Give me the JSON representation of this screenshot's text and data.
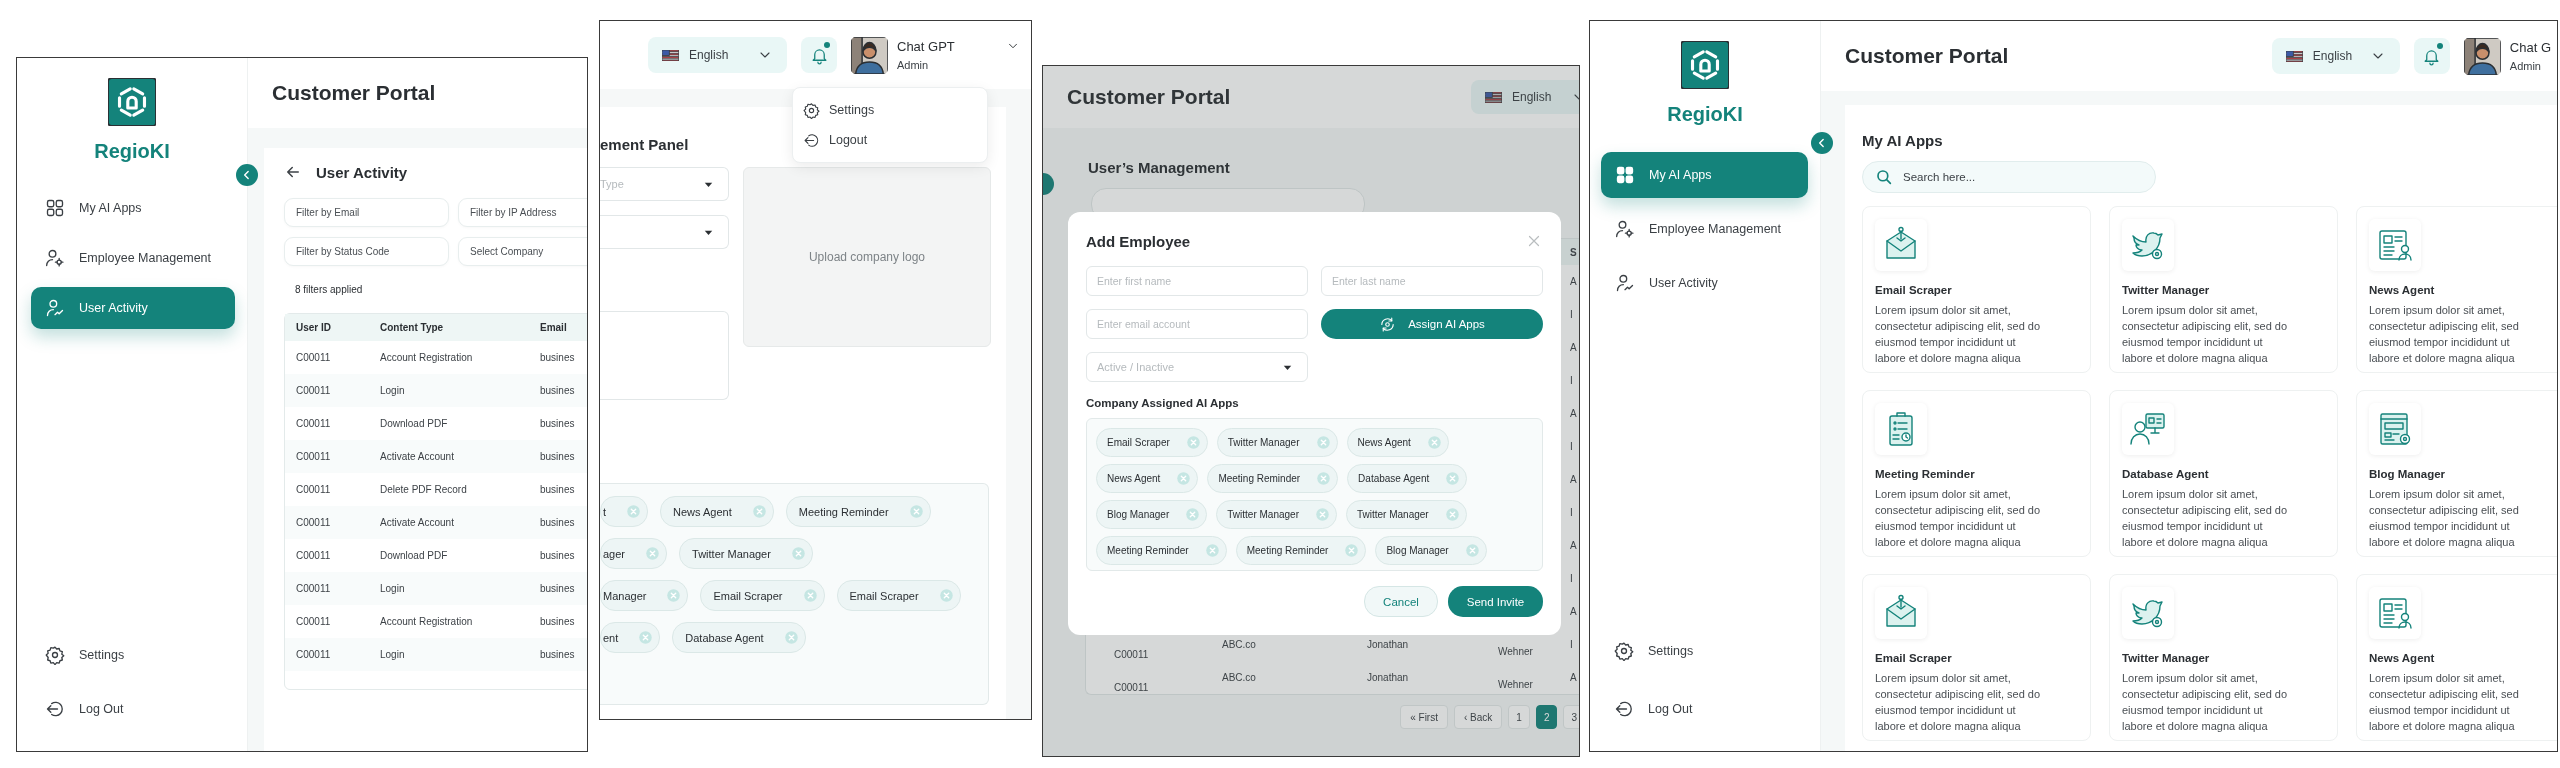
{
  "user_activity_screen": {
    "sidebar": {
      "brand": "RegioKI",
      "items": [
        {
          "label": "My AI Apps",
          "kind": "apps",
          "selected": false
        },
        {
          "label": "Employee Management",
          "kind": "employees",
          "selected": false
        },
        {
          "label": "User Activity",
          "kind": "activity",
          "selected": true
        }
      ],
      "footer_items": [
        {
          "label": "Settings",
          "kind": "settings"
        },
        {
          "label": "Log Out",
          "kind": "logout"
        }
      ]
    },
    "header": {
      "title": "Customer Portal"
    },
    "page": {
      "title": "User Activity",
      "filters": [
        {
          "placeholder": "Filter by Email"
        },
        {
          "placeholder": "Filter by IP Address"
        },
        {
          "placeholder": "Filter by Status Code"
        },
        {
          "placeholder": "Select Company"
        }
      ],
      "filter_count": "8 filters applied",
      "table": {
        "columns": [
          "User ID",
          "Content Type",
          "Email"
        ],
        "rows": [
          [
            "C00011",
            "Account Registration",
            "busines"
          ],
          [
            "C00011",
            "Login",
            "busines"
          ],
          [
            "C00011",
            "Download PDF",
            "busines"
          ],
          [
            "C00011",
            "Activate Account",
            "busines"
          ],
          [
            "C00011",
            "Delete PDF Record",
            "busines"
          ],
          [
            "C00011",
            "Activate Account",
            "busines"
          ],
          [
            "C00011",
            "Download PDF",
            "busines"
          ],
          [
            "C00011",
            "Login",
            "busines"
          ],
          [
            "C00011",
            "Account Registration",
            "busines"
          ],
          [
            "C00011",
            "Login",
            "busines"
          ]
        ]
      }
    }
  },
  "profile_menu_screen": {
    "header": {
      "language": "English",
      "user_name": "Chat GPT",
      "user_role": "Admin"
    },
    "menu": [
      {
        "label": "Settings",
        "kind": "settings"
      },
      {
        "label": "Logout",
        "kind": "logout"
      }
    ],
    "page": {
      "title": "ement Panel",
      "type_select": {
        "placeholder": "Type"
      },
      "upload_label": "Upload company logo",
      "tag_rows": [
        [
          {
            "label": "t",
            "cut": true
          },
          {
            "label": "News Agent",
            "cut": false
          },
          {
            "label": "Meeting Reminder",
            "cut": false
          }
        ],
        [
          {
            "label": "ager",
            "cut": true
          },
          {
            "label": "Twitter Manager",
            "cut": false
          }
        ],
        [
          {
            "label": "Manager",
            "cut": true
          },
          {
            "label": "Email Scraper",
            "cut": false
          },
          {
            "label": "Email Scraper",
            "cut": false
          }
        ],
        [
          {
            "label": "ent",
            "cut": true
          },
          {
            "label": "Database Agent",
            "cut": false
          }
        ]
      ]
    }
  },
  "add_employee_screen": {
    "header": {
      "title": "Customer Portal",
      "language": "English"
    },
    "page": {
      "title": "User’s Management",
      "table": {
        "last_column_header": "S",
        "rows": [
          [
            "A"
          ],
          [
            "I"
          ],
          [
            "A"
          ],
          [
            "I"
          ],
          [
            "A"
          ],
          [
            "I"
          ],
          [
            "A"
          ],
          [
            "I"
          ],
          [
            "A"
          ],
          [
            "I"
          ],
          [
            "A"
          ],
          [
            "C00011",
            "ABC.co",
            "Jonathan",
            "Wehner",
            "I"
          ],
          [
            "C00011",
            "ABC.co",
            "Jonathan",
            "Wehner",
            "A"
          ]
        ]
      },
      "pagination": {
        "first": "« First",
        "back": "‹ Back",
        "pages": [
          {
            "label": "1",
            "selected": false
          },
          {
            "label": "2",
            "selected": true
          },
          {
            "label": "3",
            "selected": false
          }
        ]
      }
    },
    "modal": {
      "title": "Add Employee",
      "fields": [
        {
          "placeholder": "Enter first name"
        },
        {
          "placeholder": "Enter last name"
        },
        {
          "placeholder": "Enter email account"
        }
      ],
      "assign_button": "Assign AI Apps",
      "status_select": {
        "placeholder": "Active / Inactive"
      },
      "section_title": "Company Assigned AI Apps",
      "tags": [
        "Email Scraper",
        "Twitter Manager",
        "News Agent",
        "News Agent",
        "Meeting Reminder",
        "Database Agent",
        "Blog Manager",
        "Twitter Manager",
        "Twitter Manager",
        "Meeting Reminder",
        "Meeting Reminder",
        "Blog Manager"
      ],
      "cancel": "Cancel",
      "submit": "Send Invite"
    }
  },
  "ai_apps_screen": {
    "sidebar": {
      "brand": "RegioKI",
      "items": [
        {
          "label": "My AI Apps",
          "kind": "apps",
          "selected": true
        },
        {
          "label": "Employee Management",
          "kind": "employees",
          "selected": false
        },
        {
          "label": "User Activity",
          "kind": "activity",
          "selected": false
        }
      ],
      "footer_items": [
        {
          "label": "Settings",
          "kind": "settings"
        },
        {
          "label": "Log Out",
          "kind": "logout"
        }
      ]
    },
    "header": {
      "title": "Customer Portal",
      "language": "English",
      "user_name": "Chat G",
      "user_role": "Admin"
    },
    "page": {
      "title": "My AI Apps",
      "search": {
        "placeholder": "Search here..."
      },
      "apps": [
        {
          "name": "Email Scraper",
          "kind": "email",
          "description": "Lorem ipsum dolor sit amet,\nconsectetur adipiscing elit, sed do\neiusmod tempor incididunt ut\nlabore et dolore magna aliqua"
        },
        {
          "name": "Twitter Manager",
          "kind": "bird",
          "description": "Lorem ipsum dolor sit amet,\nconsectetur adipiscing elit, sed do\neiusmod tempor incididunt ut\nlabore et dolore magna aliqua"
        },
        {
          "name": "News Agent",
          "kind": "news",
          "description": "Lorem ipsum dolor sit amet,\nconsectetur adipiscing elit, sed\neiusmod tempor incididunt ut\nlabore et dolore magna aliqua"
        },
        {
          "name": "Meeting Reminder",
          "kind": "meeting",
          "description": "Lorem ipsum dolor sit amet,\nconsectetur adipiscing elit, sed do\neiusmod tempor incididunt ut\nlabore et dolore magna aliqua"
        },
        {
          "name": "Database Agent",
          "kind": "database",
          "description": "Lorem ipsum dolor sit amet,\nconsectetur adipiscing elit, sed do\neiusmod tempor incididunt ut\nlabore et dolore magna aliqua"
        },
        {
          "name": "Blog Manager",
          "kind": "blog",
          "description": "Lorem ipsum dolor sit amet,\nconsectetur adipiscing elit, sed\neiusmod tempor incididunt ut\nlabore et dolore magna aliqua"
        },
        {
          "name": "Email Scraper",
          "kind": "email",
          "description": "Lorem ipsum dolor sit amet,\nconsectetur adipiscing elit, sed do\neiusmod tempor incididunt ut\nlabore et dolore magna aliqua"
        },
        {
          "name": "Twitter Manager",
          "kind": "bird",
          "description": "Lorem ipsum dolor sit amet,\nconsectetur adipiscing elit, sed do\neiusmod tempor incididunt ut\nlabore et dolore magna aliqua"
        },
        {
          "name": "News Agent",
          "kind": "news",
          "description": "Lorem ipsum dolor sit amet,\nconsectetur adipiscing elit, sed\neiusmod tempor incididunt ut\nlabore et dolore magna aliqua"
        }
      ]
    }
  }
}
